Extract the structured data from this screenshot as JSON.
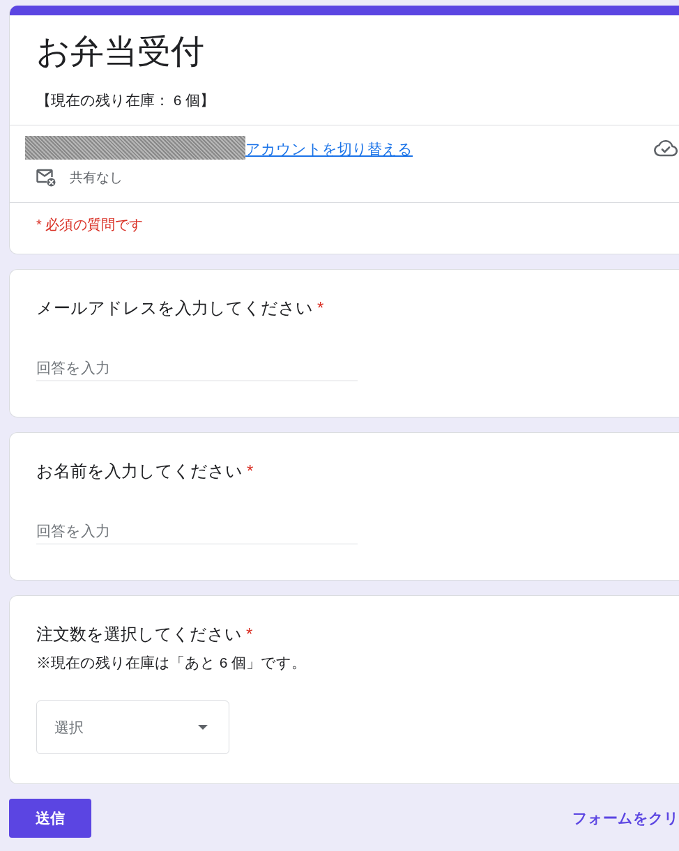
{
  "header": {
    "title": "お弁当受付",
    "description": "【現在の残り在庫： 6 個】"
  },
  "account": {
    "switch_link": "アカウントを切り替える",
    "sharing_status": "共有なし"
  },
  "required_notice": "* 必須の質問です",
  "questions": [
    {
      "kind": "text",
      "title": "メールアドレスを入力してください",
      "required_mark": "*",
      "placeholder": "回答を入力"
    },
    {
      "kind": "text",
      "title": "お名前を入力してください",
      "required_mark": "*",
      "placeholder": "回答を入力"
    },
    {
      "kind": "dropdown",
      "title": "注文数を選択してください",
      "required_mark": "*",
      "description": "※現在の残り在庫は「あと 6 個」です。",
      "placeholder": "選択"
    }
  ],
  "footer": {
    "submit_button": "送信",
    "clear_link": "フォームをクリ"
  }
}
